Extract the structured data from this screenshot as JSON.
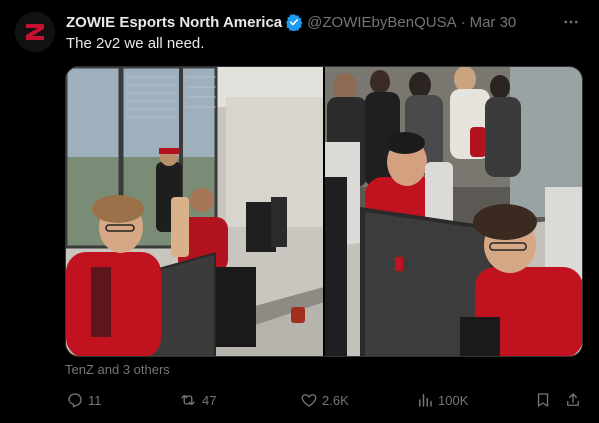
{
  "author": {
    "name": "ZOWIE Esports North America",
    "handle": "@ZOWIEbyBenQUSA",
    "separator": "·",
    "date": "Mar 30"
  },
  "tweet": {
    "text": "The 2v2 we all need."
  },
  "media": {
    "photos": [
      {
        "description": "Office room with two gamers at monitors"
      },
      {
        "description": "Crowd watching two gamers play"
      }
    ]
  },
  "tagged": "TenZ and 3 others",
  "actions": {
    "replies": "11",
    "reposts": "47",
    "likes": "2.6K",
    "views": "100K"
  },
  "colors": {
    "background": "#000000",
    "text": "#e7e9ea",
    "muted": "#71767b",
    "verified": "#1d9bf0",
    "brand_red": "#c8102e"
  },
  "icons": [
    "zowie-logo-icon",
    "verified-badge-icon",
    "more-icon",
    "reply-icon",
    "repost-icon",
    "like-icon",
    "views-icon",
    "bookmark-icon",
    "share-icon"
  ]
}
